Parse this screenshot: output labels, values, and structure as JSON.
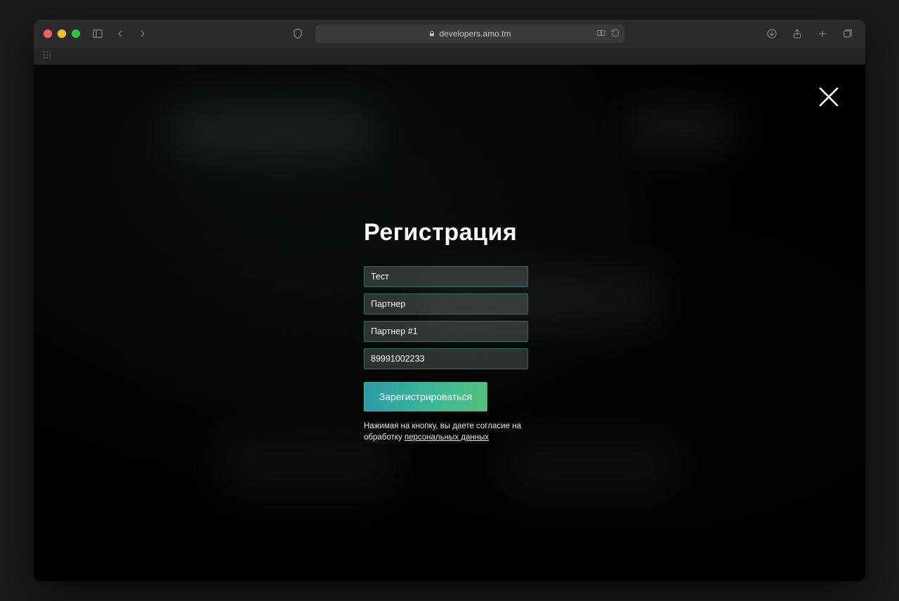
{
  "browser": {
    "url_display": "developers.amo.tm"
  },
  "modal": {
    "title": "Регистрация",
    "fields": {
      "first_name": "Тест",
      "last_name": "Партнер",
      "company": "Партнер #1",
      "phone": "89991002233"
    },
    "submit_label": "Зарегистрироваться",
    "consent_prefix": "Нажимая на кнопку, вы даете согласие на обработку",
    "consent_link": "персональных данных"
  }
}
